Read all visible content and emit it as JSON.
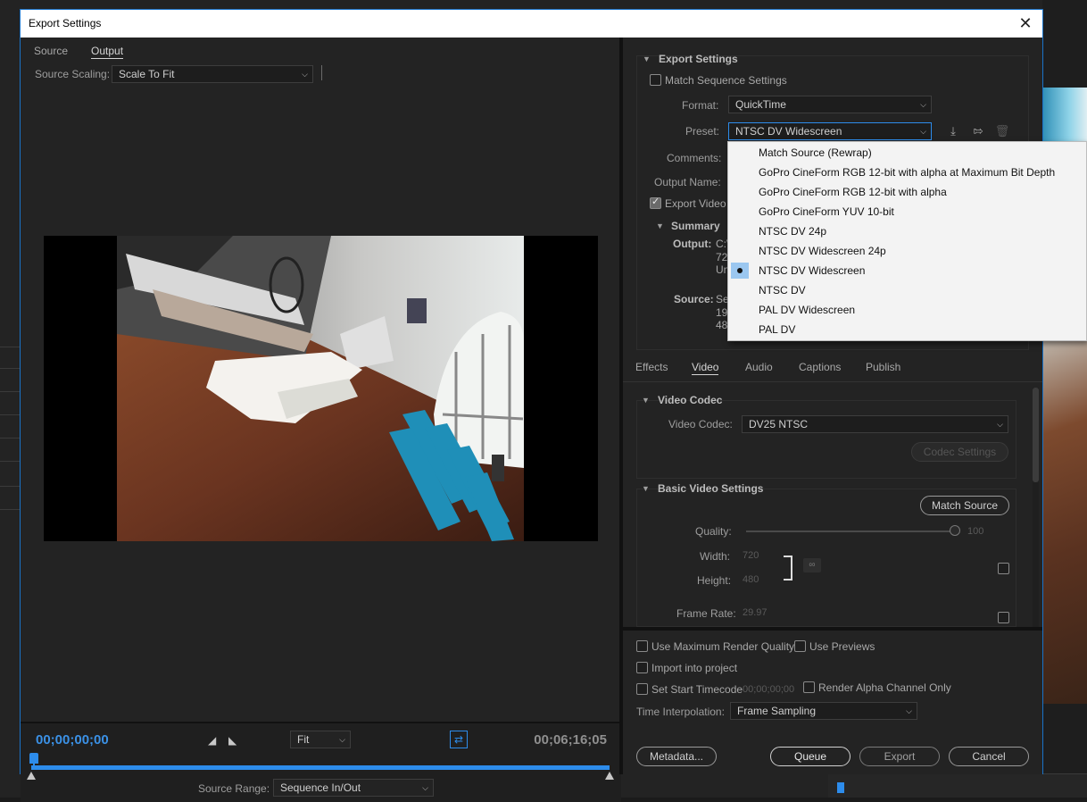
{
  "dialog": {
    "title": "Export Settings",
    "close_glyph": "✕"
  },
  "left": {
    "tabs": [
      "Source",
      "Output"
    ],
    "active_tab": "Output",
    "source_scaling_label": "Source Scaling:",
    "source_scaling_value": "Scale To Fit",
    "timecode_in": "00;00;00;00",
    "timecode_out": "00;06;16;05",
    "zoom_value": "Fit",
    "source_range_label": "Source Range:",
    "source_range_value": "Sequence In/Out"
  },
  "export_settings": {
    "section_title": "Export Settings",
    "match_sequence_label": "Match Sequence Settings",
    "format_label": "Format:",
    "format_value": "QuickTime",
    "preset_label": "Preset:",
    "preset_value": "NTSC DV Widescreen",
    "comments_label": "Comments:",
    "output_name_label": "Output Name:",
    "export_video_label": "Export Video",
    "summary_title": "Summary",
    "output_label": "Output:",
    "output_lines": [
      "C:\\",
      "72",
      "Un"
    ],
    "source_label": "Source:",
    "source_lines": [
      "Se",
      "19",
      "48"
    ]
  },
  "preset_menu": {
    "items": [
      "Match Source (Rewrap)",
      "GoPro CineForm RGB 12-bit with alpha at Maximum Bit Depth",
      "GoPro CineForm RGB 12-bit with alpha",
      "GoPro CineForm YUV 10-bit",
      "NTSC DV 24p",
      "NTSC DV Widescreen 24p",
      "NTSC DV Widescreen",
      "NTSC DV",
      "PAL DV Widescreen",
      "PAL DV"
    ],
    "selected_index": 6
  },
  "settings_tabs": [
    "Effects",
    "Video",
    "Audio",
    "Captions",
    "Publish"
  ],
  "active_settings_tab": "Video",
  "video_codec": {
    "section_title": "Video Codec",
    "codec_label": "Video Codec:",
    "codec_value": "DV25 NTSC",
    "codec_settings_label": "Codec Settings"
  },
  "basic_video": {
    "section_title": "Basic Video Settings",
    "match_source_label": "Match Source",
    "quality_label": "Quality:",
    "quality_value": "100",
    "width_label": "Width:",
    "width_value": "720",
    "height_label": "Height:",
    "height_value": "480",
    "frame_rate_label": "Frame Rate:",
    "frame_rate_value": "29.97"
  },
  "bottom": {
    "max_render_quality": "Use Maximum Render Quality",
    "use_previews": "Use Previews",
    "import_into_project": "Import into project",
    "set_start_timecode": "Set Start Timecode",
    "start_timecode_value": "00;00;00;00",
    "render_alpha": "Render Alpha Channel Only",
    "time_interp_label": "Time Interpolation:",
    "time_interp_value": "Frame Sampling",
    "metadata_btn": "Metadata...",
    "queue_btn": "Queue",
    "export_btn": "Export",
    "cancel_btn": "Cancel"
  },
  "colors": {
    "accent": "#2d8ceb",
    "timecode": "#3b91e6",
    "menu_selection": "#9bc7f0"
  }
}
